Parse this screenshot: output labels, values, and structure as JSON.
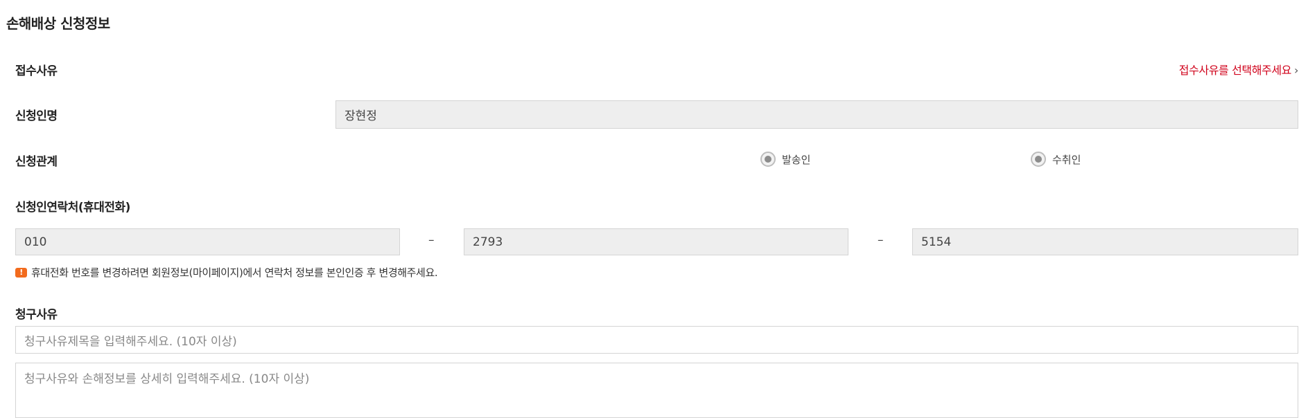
{
  "section": {
    "title": "손해배상 신청정보"
  },
  "reason": {
    "label": "접수사유",
    "select_link": "접수사유를 선택해주세요",
    "chevron": "›"
  },
  "applicant": {
    "label": "신청인명",
    "name_value": "장현정"
  },
  "relation": {
    "label": "신청관계",
    "options": [
      {
        "label": "발송인",
        "selected": true
      },
      {
        "label": "수취인",
        "selected": true
      }
    ]
  },
  "phone": {
    "label": "신청인연락처(휴대전화)",
    "part1": "010",
    "part2": "2793",
    "part3": "5154",
    "separator": "–",
    "notice_icon": "!",
    "notice": "휴대전화 번호를 변경하려면 회원정보(마이페이지)에서 연락처 정보를 본인인증 후 변경해주세요."
  },
  "claim": {
    "label": "청구사유",
    "title_placeholder": "청구사유제목을 입력해주세요. (10자 이상)",
    "detail_placeholder": "청구사유와 손해정보를 상세히 입력해주세요. (10자 이상)"
  },
  "colors": {
    "accent_red": "#d0021b",
    "warning_orange": "#f26b1d",
    "readonly_bg": "#eeeeee"
  }
}
